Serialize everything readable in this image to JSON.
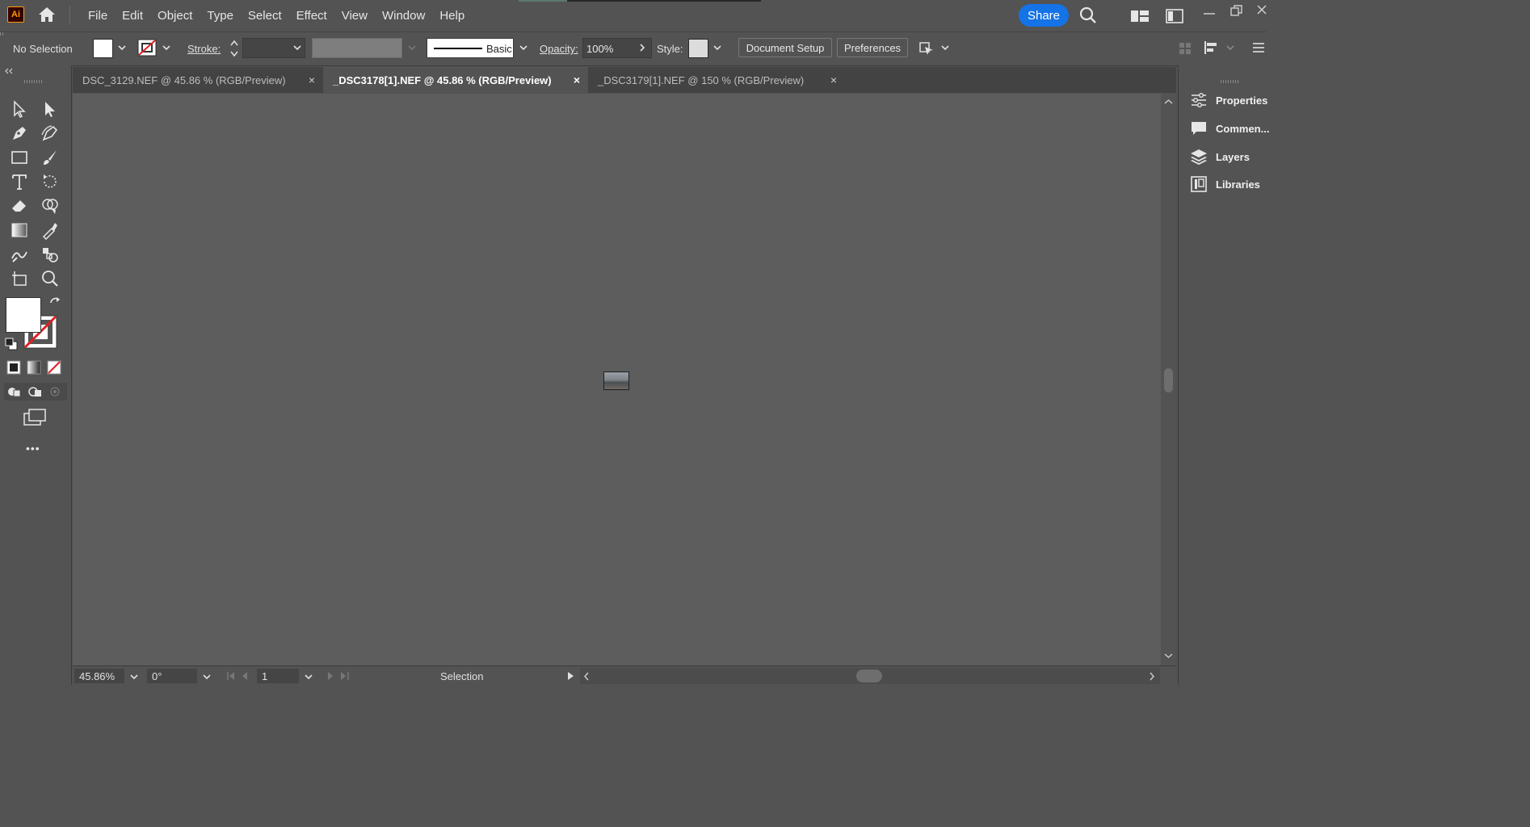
{
  "app": {
    "logo": "Ai",
    "menus": [
      "File",
      "Edit",
      "Object",
      "Type",
      "Select",
      "Effect",
      "View",
      "Window",
      "Help"
    ],
    "share_label": "Share"
  },
  "control_bar": {
    "selection_status": "No Selection",
    "stroke_label": "Stroke:",
    "brush_label": "Basic",
    "opacity_label": "Opacity:",
    "opacity_value": "100%",
    "style_label": "Style:",
    "document_setup_label": "Document Setup",
    "preferences_label": "Preferences"
  },
  "tabs": [
    {
      "label": "DSC_3129.NEF @ 45.86 % (RGB/Preview)",
      "active": false
    },
    {
      "label": "_DSC3178[1].NEF @ 45.86 % (RGB/Preview)",
      "active": true
    },
    {
      "label": "_DSC3179[1].NEF @ 150 % (RGB/Preview)",
      "active": false
    }
  ],
  "tab_close_glyph": "×",
  "status_bar": {
    "zoom": "45.86%",
    "rotation": "0°",
    "artboard": "1",
    "tool_name": "Selection"
  },
  "right_panel": {
    "items": [
      {
        "label": "Properties",
        "icon": "properties-icon"
      },
      {
        "label": "Commen...",
        "icon": "comments-icon"
      },
      {
        "label": "Layers",
        "icon": "layers-icon"
      },
      {
        "label": "Libraries",
        "icon": "libraries-icon"
      }
    ]
  },
  "toolbar": {
    "more_glyph": "•••"
  },
  "colors": {
    "share_blue": "#1473e6",
    "panel_gray": "#535353",
    "canvas_gray": "#5d5d5d",
    "none_red": "#e21f26"
  }
}
